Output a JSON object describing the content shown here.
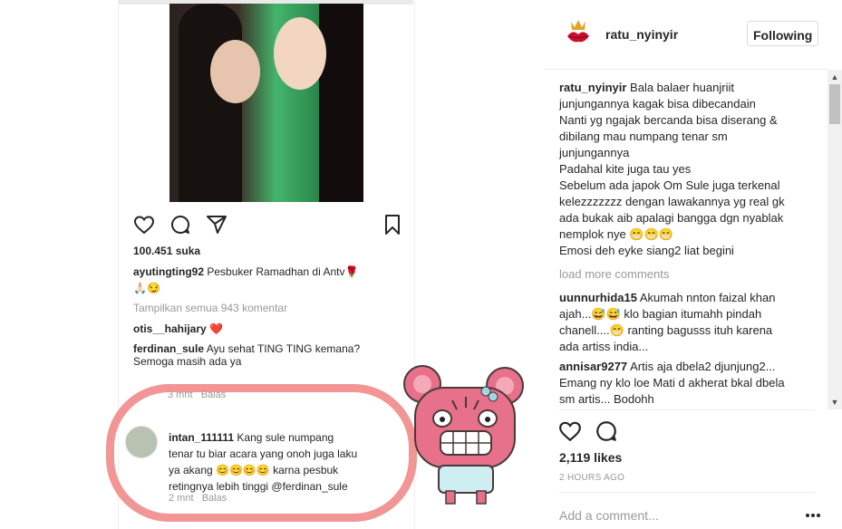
{
  "embedded": {
    "likes": "100.451 suka",
    "caption_user": "ayutingting92",
    "caption_text": "Pesbuker Ramadhan di Antv🌹",
    "caption_emoji": "🙏🏻😏",
    "view_all": "Tampilkan semua 943 komentar",
    "c1_user": "otis__hahijary",
    "c1_text": "❤️",
    "c2_user": "ferdinan_sule",
    "c2_text_a": "Ayu sehat TING TING kemana?",
    "c2_text_b": "Semoga masih ada ya",
    "c2_time": "3 mnt",
    "c2_reply": "Balas",
    "highlight_user": "intan_111111",
    "highlight_line1": "Kang sule numpang",
    "highlight_line2": "tenar tu biar acara yang onoh juga laku",
    "highlight_line3": "ya akang 😊😊😊😊 karna pesbuk",
    "highlight_line4": "retingnya lebih tinggi  @ferdinan_sule",
    "highlight_time": "2 mnt",
    "highlight_reply": "Balas"
  },
  "post": {
    "username": "ratu_nyinyir",
    "follow_label": "Following",
    "caption_lines": [
      "Bala balaer huanjriit",
      "junjungannya kagak bisa dibecandain",
      "Nanti yg ngajak bercanda bisa diserang &",
      "dibilang mau numpang tenar sm",
      "junjungannya",
      "Padahal kite juga tau yes",
      "Sebelum ada japok Om Sule juga terkenal",
      "kelezzzzzzz dengan lawakannya yg real gk",
      "ada bukak aib apalagi bangga dgn nyablak",
      "nemplok nye 😁😁😁",
      "Emosi deh eyke siang2 liat begini"
    ],
    "load_more": "load more comments",
    "comments": [
      {
        "user": "uunnurhida15",
        "lines": [
          "Akumah nnton faizal khan",
          "ajah...😅😅 klo bagian itumahh pindah",
          "chanell....😁 ranting bagusss ituh karena",
          "ada artiss india..."
        ]
      },
      {
        "user": "annisar9277",
        "lines": [
          "Artis aja dbela2 djunjung2...",
          "Emang ny klo loe Mati d akherat bkal dbela",
          "sm artis... Bodohh"
        ]
      }
    ],
    "likes": "2,119 likes",
    "time_ago": "2 HOURS AGO",
    "add_comment_placeholder": "Add a comment..."
  }
}
